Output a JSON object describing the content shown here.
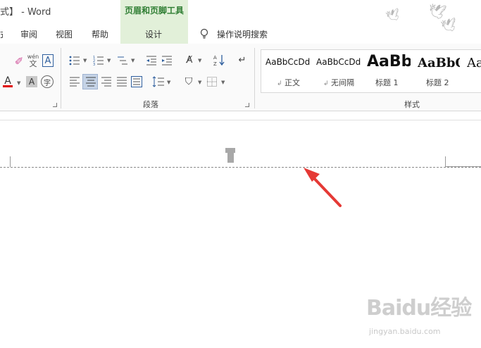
{
  "window": {
    "title": "式】 - Word"
  },
  "context_tools": {
    "group_title": "页眉和页脚工具",
    "tab_label": "设计"
  },
  "tabs": [
    {
      "label": "审阅"
    },
    {
      "label": "视图"
    },
    {
      "label": "帮助"
    }
  ],
  "tell_me": {
    "label": "操作说明搜索"
  },
  "ribbon": {
    "font_group": {
      "pinyin_label": "wén",
      "pinyin_char": "文"
    },
    "paragraph_group": {
      "label": "段落"
    },
    "styles_group": {
      "label": "样式"
    }
  },
  "styles": [
    {
      "sample": "AaBbCcDd",
      "name": "正文"
    },
    {
      "sample": "AaBbCcDd",
      "name": "无间隔"
    },
    {
      "sample": "AaBb",
      "name": "标题 1"
    },
    {
      "sample": "AaBbC",
      "name": "标题 2"
    },
    {
      "sample": "Aa",
      "name": ""
    }
  ],
  "watermark": {
    "brand": "Baidu经验",
    "url": "jingyan.baidu.com"
  },
  "colors": {
    "accent_green": "#2e7d32",
    "context_bg": "#e2f0d9",
    "arrow_red": "#e53935",
    "font_color_red": "#e00000"
  }
}
